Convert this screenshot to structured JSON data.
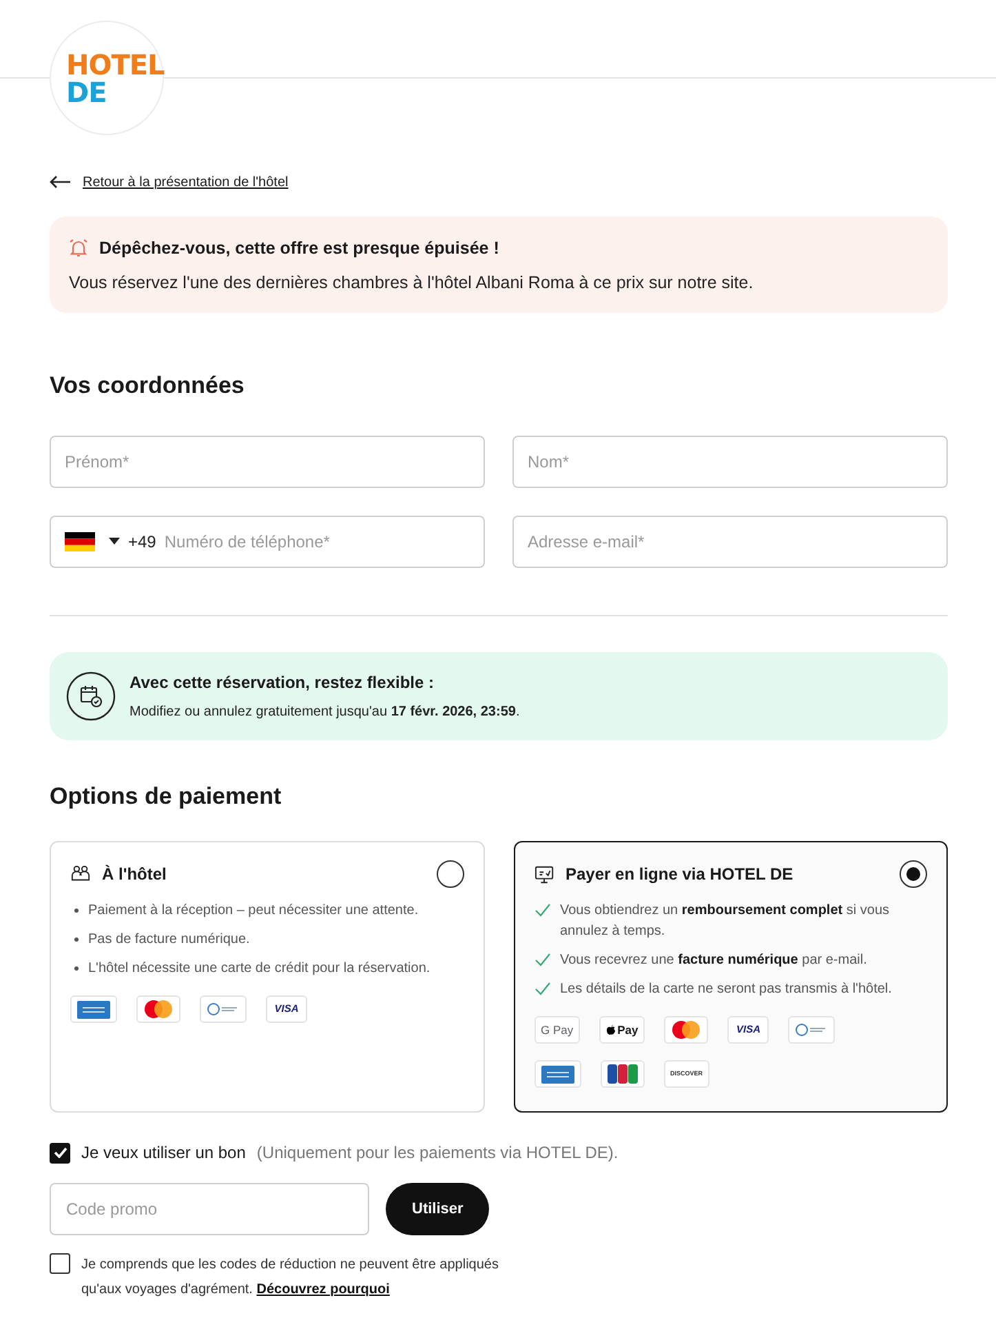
{
  "logo": {
    "line1": "HOTEL",
    "line2": "DE"
  },
  "back_link": "Retour à la présentation de l'hôtel",
  "alert": {
    "title": "Dépêchez-vous, cette offre est presque épuisée !",
    "text": "Vous réservez l'une des dernières chambres à l'hôtel Albani Roma à ce prix sur notre site."
  },
  "contact": {
    "title": "Vos coordonnées",
    "fields": [
      {
        "kind": "text",
        "placeholder": "Prénom*"
      },
      {
        "kind": "text",
        "placeholder": "Nom*"
      },
      {
        "kind": "phone",
        "prefix": "+49",
        "placeholder": "Numéro de téléphone*"
      },
      {
        "kind": "text",
        "placeholder": "Adresse e-mail*"
      }
    ]
  },
  "flexible": {
    "title": "Avec cette réservation, restez flexible :",
    "text": "Modifiez ou annulez gratuitement jusqu'au **17 févr. 2026, 23:59**."
  },
  "payment": {
    "title": "Options de paiement",
    "options": [
      {
        "kind": "at_hotel",
        "title": "À l'hôtel",
        "selected": false,
        "points": [
          "Paiement à la réception – peut nécessiter une attente.",
          "Pas de facture numérique.",
          "L'hôtel nécessite une carte de crédit pour la réservation."
        ],
        "methods": [
          {
            "kind": "amex"
          },
          {
            "kind": "mastercard"
          },
          {
            "kind": "diners"
          },
          {
            "kind": "visa",
            "label": "VISA"
          }
        ]
      },
      {
        "kind": "online",
        "title": "Payer en ligne via HOTEL DE",
        "selected": true,
        "points": [
          "Vous obtiendrez un **remboursement complet** si vous annulez à temps.",
          "Vous recevrez une **facture numérique** par e-mail.",
          "Les détails de la carte ne seront pas transmis à l'hôtel."
        ],
        "methods": [
          {
            "kind": "gpay",
            "label": "G Pay"
          },
          {
            "kind": "applepay",
            "label": "Pay"
          },
          {
            "kind": "mastercard"
          },
          {
            "kind": "visa",
            "label": "VISA"
          },
          {
            "kind": "diners"
          },
          {
            "kind": "amex"
          },
          {
            "kind": "jcb"
          },
          {
            "kind": "discover",
            "label": "DISCOVER"
          }
        ]
      }
    ]
  },
  "voucher": {
    "checked": true,
    "label": "Je veux utiliser un bon",
    "note": "(Uniquement pour les paiements via HOTEL DE).",
    "placeholder": "Code promo",
    "button": "Utiliser"
  },
  "consent": {
    "checked": false,
    "text": "Je comprends que les codes de réduction ne peuvent être appliqués qu'aux voyages d'agrément.",
    "link": "Découvrez pourquoi"
  }
}
